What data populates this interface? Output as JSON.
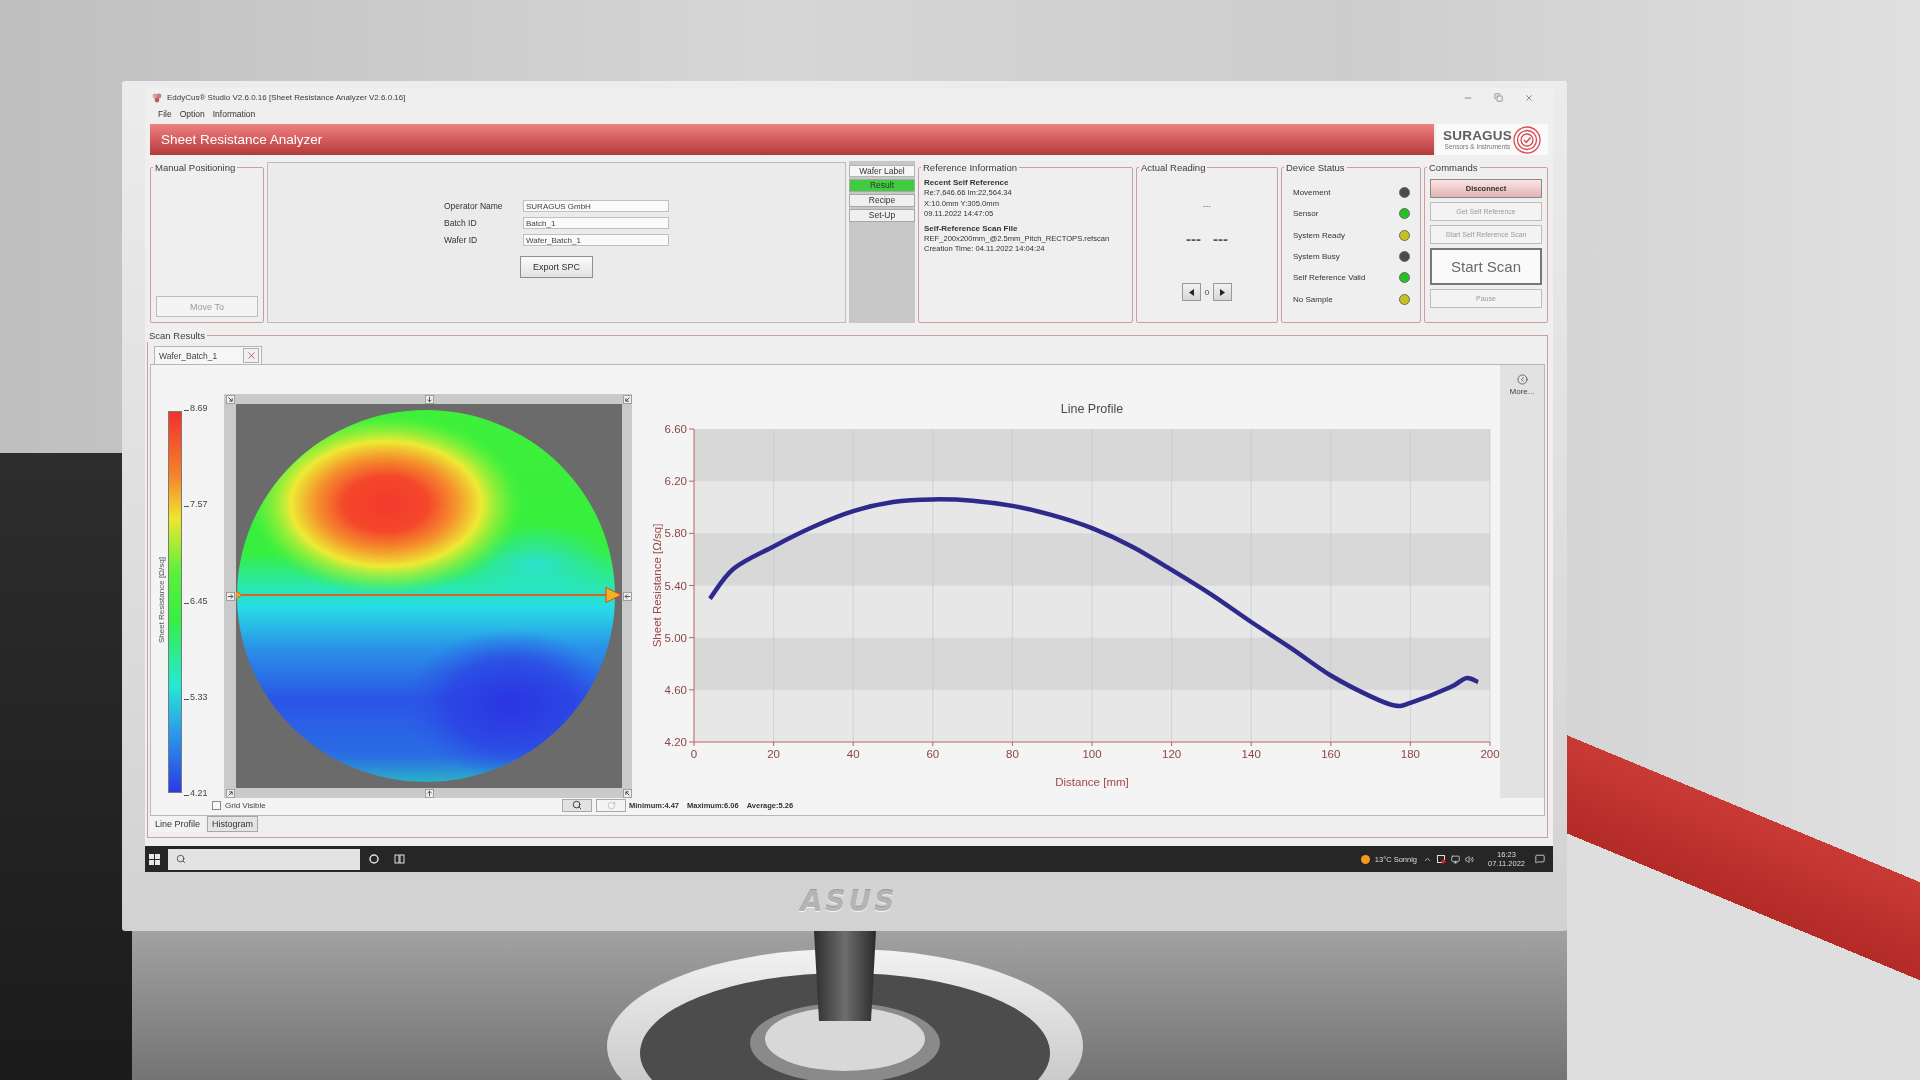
{
  "window": {
    "title": "EddyCus® Studio V2.6.0.16 [Sheet Resistance Analyzer V2.6.0.16]",
    "menu": [
      "File",
      "Option",
      "Information"
    ]
  },
  "header": {
    "title": "Sheet Resistance Analyzer",
    "logo": "SURAGUS",
    "tagline": "Sensors & Instruments"
  },
  "manual_positioning": {
    "title": "Manual Positioning",
    "button": {
      "label": "Move To",
      "disabled": true
    }
  },
  "wafer_info": {
    "fields": [
      {
        "label": "Operator Name",
        "value": "SURAGUS GmbH"
      },
      {
        "label": "Batch ID",
        "value": "Batch_1"
      },
      {
        "label": "Wafer ID",
        "value": "Wafer_Batch_1"
      }
    ],
    "button": "Export SPC"
  },
  "wafer_label": {
    "title": "Wafer Label",
    "tabs": [
      {
        "label": "Result",
        "selected": true
      },
      {
        "label": "Recipe",
        "selected": false
      },
      {
        "label": "Set-Up",
        "selected": false
      }
    ]
  },
  "reference_information": {
    "title": "Reference Information",
    "sections": [
      {
        "heading": "Recent Self Reference",
        "lines": [
          "Re:7,646.66 Im:22,564.34",
          "X:10.0mm Y:305.0mm",
          "09.11.2022 14:47:05"
        ]
      },
      {
        "heading": "Self-Reference Scan File",
        "lines": [
          "REF_200x200mm_@2.5mm_Pitch_RECTOPS.refscan",
          "Creation Time: 04.11.2022 14:04:24"
        ]
      }
    ]
  },
  "actual_reading": {
    "title": "Actual Reading",
    "status": "---",
    "values": [
      "---",
      "---"
    ],
    "index": "0"
  },
  "device_status": {
    "title": "Device Status",
    "items": [
      {
        "label": "Movement",
        "color": "#4a4a4a"
      },
      {
        "label": "Sensor",
        "color": "#22c422"
      },
      {
        "label": "System Ready",
        "color": "#c9c21e"
      },
      {
        "label": "System Busy",
        "color": "#4a4a4a"
      },
      {
        "label": "Self Reference Valid",
        "color": "#22c422"
      },
      {
        "label": "No Sample",
        "color": "#c9c21e"
      }
    ]
  },
  "commands": {
    "title": "Commands",
    "buttons": [
      {
        "label": "Disconnect",
        "kind": "primary",
        "disabled": false
      },
      {
        "label": "Get Self Reference",
        "kind": "small",
        "disabled": true
      },
      {
        "label": "Start Self Reference Scan",
        "kind": "small",
        "disabled": true
      },
      {
        "label": "Start Scan",
        "kind": "large",
        "disabled": false
      },
      {
        "label": "Pause",
        "kind": "small",
        "disabled": true
      }
    ]
  },
  "scan_results": {
    "title": "Scan Results",
    "tabs": [
      {
        "label": "Wafer_Batch_1",
        "selected": true
      }
    ],
    "color_scale": {
      "label": "Sheet Resistance [Ω/sq]",
      "ticks": [
        "8.69",
        "7.57",
        "6.45",
        "5.33",
        "4.21"
      ]
    },
    "grid_visible": {
      "label": "Grid Visible",
      "checked": false
    },
    "stats": [
      "Minimum:4.47",
      "Maximum:6.06",
      "Average:5.26"
    ],
    "more": "More...",
    "chart_data": {
      "type": "line",
      "title": "Line Profile",
      "xlabel": "Distance [mm]",
      "ylabel": "Sheet Resistance [Ω/sq]",
      "x": [
        4,
        10,
        20,
        30,
        40,
        50,
        60,
        70,
        80,
        90,
        100,
        110,
        120,
        130,
        140,
        150,
        160,
        170,
        176,
        180,
        190,
        194,
        197
      ],
      "series": [
        {
          "color": "#2d2a8c",
          "values": [
            5.3,
            5.53,
            5.7,
            5.85,
            5.97,
            6.04,
            6.06,
            6.05,
            6.01,
            5.94,
            5.84,
            5.7,
            5.52,
            5.33,
            5.12,
            4.92,
            4.71,
            4.55,
            4.48,
            4.5,
            4.62,
            4.69,
            4.66
          ]
        }
      ],
      "xlim": [
        0,
        200
      ],
      "ylim": [
        4.2,
        6.6
      ],
      "xticks": [
        0,
        20,
        40,
        60,
        80,
        100,
        120,
        140,
        160,
        180,
        200
      ],
      "yticks": [
        {
          "value": 4.2,
          "label": "4.20"
        },
        {
          "value": 4.6,
          "label": "4.60"
        },
        {
          "value": 5.0,
          "label": "5.00"
        },
        {
          "value": 5.4,
          "label": "5.40"
        },
        {
          "value": 5.8,
          "label": "5.80"
        },
        {
          "value": 6.2,
          "label": "6.20"
        },
        {
          "value": 6.6,
          "label": "6.60"
        }
      ],
      "grid": true
    },
    "view_tabs": [
      {
        "label": "Line Profile",
        "selected": true
      },
      {
        "label": "Histogram",
        "selected": false
      }
    ]
  },
  "taskbar": {
    "weather": "13°C Sonnig",
    "time": "16:23",
    "date": "07.11.2022"
  },
  "monitor": {
    "brand": "ASUS"
  }
}
